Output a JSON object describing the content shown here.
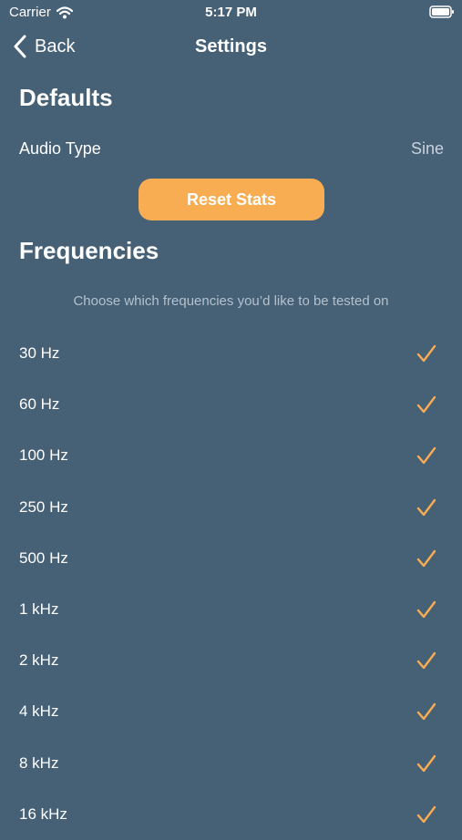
{
  "status_bar": {
    "carrier": "Carrier",
    "time": "5:17 PM"
  },
  "nav": {
    "back_label": "Back",
    "title": "Settings"
  },
  "defaults": {
    "section_title": "Defaults",
    "audio_type_label": "Audio Type",
    "audio_type_value": "Sine",
    "reset_label": "Reset Stats"
  },
  "frequencies": {
    "section_title": "Frequencies",
    "hint": "Choose which frequencies you’d like to be tested on",
    "items": [
      {
        "label": "30 Hz",
        "checked": true
      },
      {
        "label": "60 Hz",
        "checked": true
      },
      {
        "label": "100 Hz",
        "checked": true
      },
      {
        "label": "250 Hz",
        "checked": true
      },
      {
        "label": "500 Hz",
        "checked": true
      },
      {
        "label": "1 kHz",
        "checked": true
      },
      {
        "label": "2 kHz",
        "checked": true
      },
      {
        "label": "4 kHz",
        "checked": true
      },
      {
        "label": "8 kHz",
        "checked": true
      },
      {
        "label": "16 kHz",
        "checked": true
      }
    ]
  },
  "colors": {
    "background": "#466076",
    "accent": "#f8ad53"
  }
}
